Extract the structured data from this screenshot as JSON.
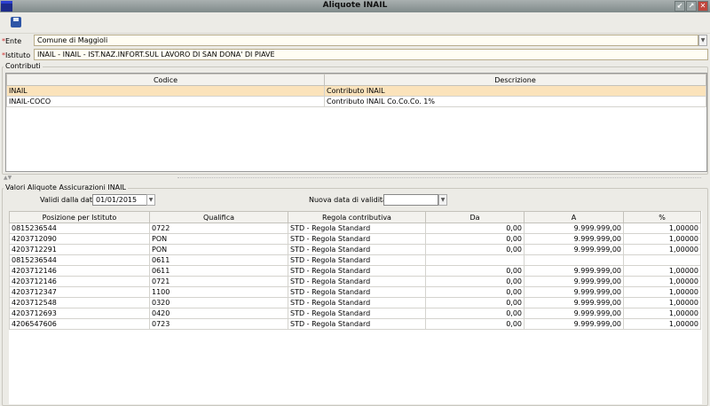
{
  "window": {
    "title": "Aliquote INAIL",
    "controls": [
      "minimize",
      "maximize",
      "close"
    ]
  },
  "toolbar": {
    "save_icon": "floppy-disk-icon"
  },
  "form": {
    "ente_label": "Ente",
    "ente_value": "Comune di Maggioli",
    "istituto_label": "Istituto",
    "istituto_value": "INAIL - INAIL - IST.NAZ.INFORT.SUL LAVORO DI SAN DONA' DI PIAVE"
  },
  "contributi": {
    "legend": "Contributi",
    "columns": [
      "Codice",
      "Descrizione"
    ],
    "rows": [
      [
        "INAIL",
        "Contributo INAIL"
      ],
      [
        "INAIL-COCO",
        "Contributo INAIL Co.Co.Co. 1%"
      ]
    ]
  },
  "valori": {
    "legend": "Valori Aliquote Assicurazioni INAIL",
    "validi_label": "Validi dalla data",
    "validi_value": "01/01/2015",
    "nuova_label": "Nuova data di validita`",
    "nuova_value": "",
    "columns": [
      "Posizione per Istituto",
      "Qualifica",
      "Regola contributiva",
      "Da",
      "A",
      "%"
    ],
    "rows": [
      [
        "0815236544",
        "0722",
        "STD - Regola Standard",
        "0,00",
        "9.999.999,00",
        "1,00000"
      ],
      [
        "4203712090",
        "PON",
        "STD - Regola Standard",
        "0,00",
        "9.999.999,00",
        "1,00000"
      ],
      [
        "4203712291",
        "PON",
        "STD - Regola Standard",
        "0,00",
        "9.999.999,00",
        "1,00000"
      ],
      [
        "0815236544",
        "0611",
        "STD - Regola Standard",
        "",
        "",
        ""
      ],
      [
        "4203712146",
        "0611",
        "STD - Regola Standard",
        "0,00",
        "9.999.999,00",
        "1,00000"
      ],
      [
        "4203712146",
        "0721",
        "STD - Regola Standard",
        "0,00",
        "9.999.999,00",
        "1,00000"
      ],
      [
        "4203712347",
        "1100",
        "STD - Regola Standard",
        "0,00",
        "9.999.999,00",
        "1,00000"
      ],
      [
        "4203712548",
        "0320",
        "STD - Regola Standard",
        "0,00",
        "9.999.999,00",
        "1,00000"
      ],
      [
        "4203712693",
        "0420",
        "STD - Regola Standard",
        "0,00",
        "9.999.999,00",
        "1,00000"
      ],
      [
        "4206547606",
        "0723",
        "STD - Regola Standard",
        "0,00",
        "9.999.999,00",
        "1,00000"
      ]
    ]
  }
}
